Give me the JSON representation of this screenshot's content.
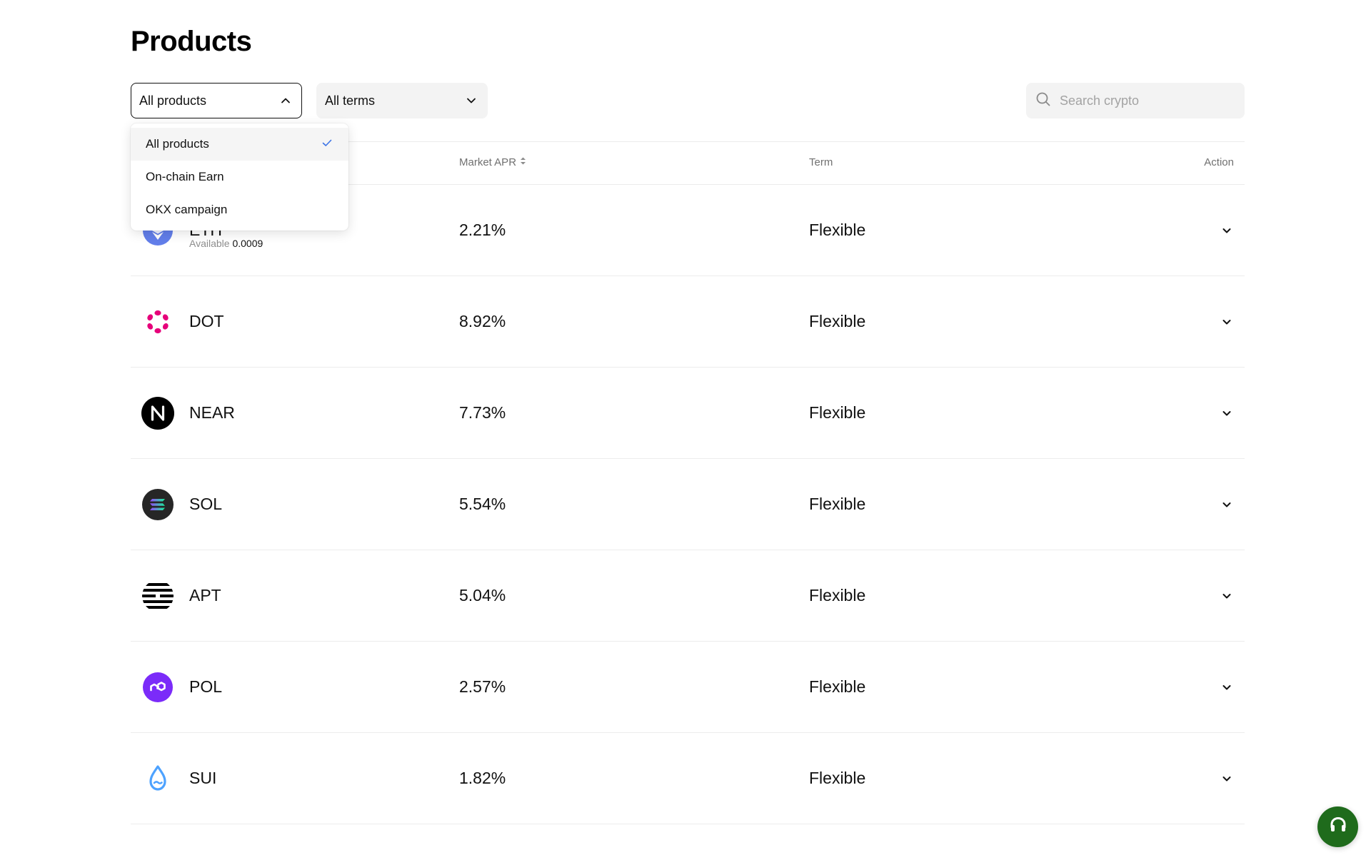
{
  "page": {
    "title": "Products"
  },
  "filters": {
    "products": {
      "selected": "All products"
    },
    "terms": {
      "selected": "All terms"
    }
  },
  "search": {
    "placeholder": "Search crypto"
  },
  "dropdown": {
    "options": [
      {
        "label": "All products",
        "selected": true
      },
      {
        "label": "On-chain Earn",
        "selected": false
      },
      {
        "label": "OKX campaign",
        "selected": false
      }
    ]
  },
  "table": {
    "columns": {
      "apr": "Market APR",
      "term": "Term",
      "action": "Action"
    },
    "rows": [
      {
        "name": "ETH",
        "available_label": "Available",
        "available_value": "0.0009",
        "apr": "2.21%",
        "term": "Flexible",
        "icon": "eth-icon",
        "color": "#627eea"
      },
      {
        "name": "DOT",
        "apr": "8.92%",
        "term": "Flexible",
        "icon": "dot-icon",
        "color": "#e6007a"
      },
      {
        "name": "NEAR",
        "apr": "7.73%",
        "term": "Flexible",
        "icon": "near-icon",
        "color": "#000000"
      },
      {
        "name": "SOL",
        "apr": "5.54%",
        "term": "Flexible",
        "icon": "sol-icon",
        "color": "#262626"
      },
      {
        "name": "APT",
        "apr": "5.04%",
        "term": "Flexible",
        "icon": "apt-icon",
        "color": "#000000"
      },
      {
        "name": "POL",
        "apr": "2.57%",
        "term": "Flexible",
        "icon": "pol-icon",
        "color": "#7b2bf9"
      },
      {
        "name": "SUI",
        "apr": "1.82%",
        "term": "Flexible",
        "icon": "sui-icon",
        "color": "#4da2ff"
      }
    ]
  },
  "support": {
    "icon": "headset-icon",
    "color": "#1f6b1c"
  }
}
